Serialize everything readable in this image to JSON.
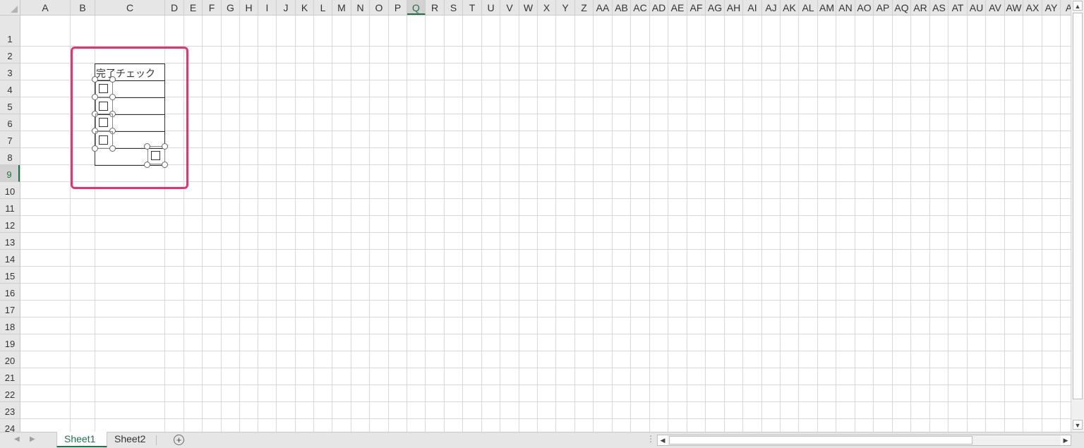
{
  "columns": [
    "A",
    "B",
    "C",
    "D",
    "E",
    "F",
    "G",
    "H",
    "I",
    "J",
    "K",
    "L",
    "M",
    "N",
    "O",
    "P",
    "Q",
    "R",
    "S",
    "T",
    "U",
    "V",
    "W",
    "X",
    "Y",
    "Z",
    "AA",
    "AB",
    "AC",
    "AD",
    "AE",
    "AF",
    "AG",
    "AH",
    "AI",
    "AJ",
    "AK",
    "AL",
    "AM",
    "AN",
    "AO",
    "AP",
    "AQ",
    "AR",
    "AS",
    "AT",
    "AU",
    "AV",
    "AW",
    "AX",
    "AY",
    "A"
  ],
  "active_column": "Q",
  "rows": [
    "1",
    "2",
    "3",
    "4",
    "5",
    "6",
    "7",
    "8",
    "9",
    "10",
    "11",
    "12",
    "13",
    "14",
    "15",
    "16",
    "17",
    "18",
    "19",
    "20",
    "21",
    "22",
    "23",
    "24"
  ],
  "active_row": "9",
  "cells": {
    "C3": "完了チェック"
  },
  "checkbox_labels": [
    "□",
    "□",
    "□",
    "□",
    "□"
  ],
  "sheet_tabs": [
    {
      "label": "Sheet1",
      "active": true
    },
    {
      "label": "Sheet2",
      "active": false
    }
  ],
  "add_sheet_label": "+",
  "scroll": {
    "up": "▲",
    "down": "▼",
    "left": "◀",
    "right": "▶",
    "nav_prev": "◀",
    "nav_next": "▶",
    "split": "⋮"
  },
  "colors": {
    "accent": "#217346",
    "highlight": "#e8336d",
    "gridline": "#d9d9d9"
  }
}
